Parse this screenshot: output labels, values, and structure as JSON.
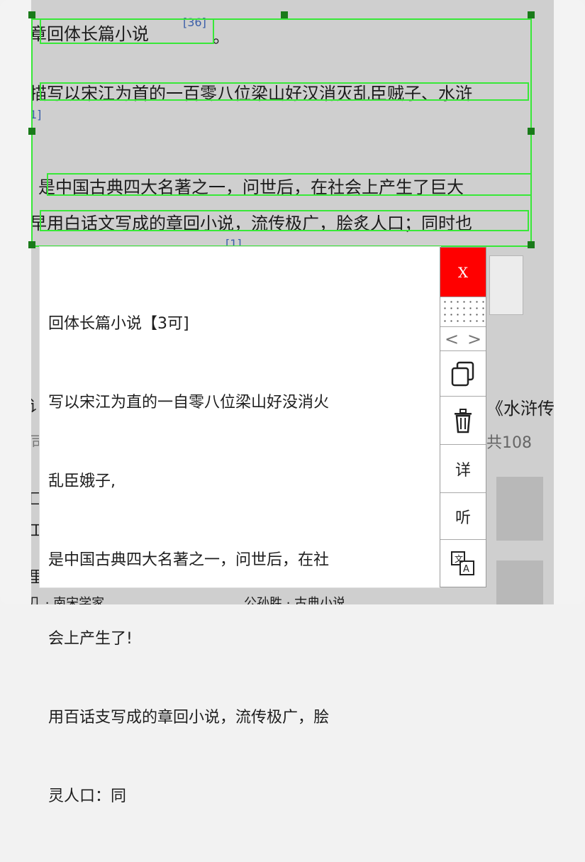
{
  "background": {
    "lines": [
      "章回体长篇小说",
      "描写以宋江为首的一百零八位梁山好汉消灭乱臣贼子、水浒",
      "》是中国古典四大名著之一，问世后，在社会上产生了巨大",
      "早用白话文写成的章回小说，流传极广，脍炙人口；同时也"
    ],
    "ref_36": "[36]",
    "ref_1": "1]",
    "ref_1b": "[1]",
    "period": "。",
    "right_title": "《水浒传",
    "right_count": "共108",
    "left_lower_1": "讠",
    "left_lower_2": "同",
    "left_lower_3": "匚",
    "left_lower_4": "工",
    "left_lower_5": "里",
    "bottom_text_1": "几 · 南宋学家",
    "bottom_text_2": "公孙胜 · 古典小说"
  },
  "ocr_result": {
    "lines": [
      "回体长篇小说【3可]",
      "写以宋江为直的一自零八位梁山好没消火",
      "乱臣娥子,",
      "是中国古典四大名著之一，问世后，在社",
      "会上产生了!",
      "用百话支写成的章回小说，流传极广，脍",
      "灵人口：同"
    ]
  },
  "toolbar": {
    "close_label": "X",
    "nav_prev": "<",
    "nav_next": ">",
    "detail_label": "详",
    "listen_label": "听"
  },
  "colors": {
    "selection_box": "#38e838",
    "handle": "#1a7a1a",
    "close_bg": "#ff0000"
  }
}
